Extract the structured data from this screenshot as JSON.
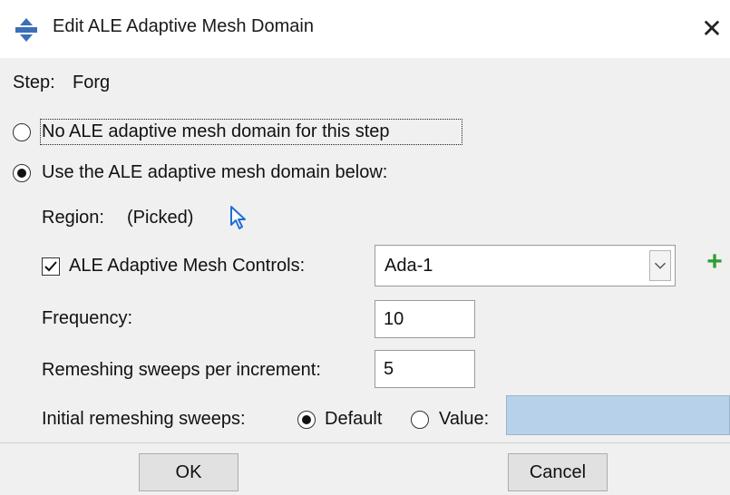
{
  "window": {
    "title": "Edit ALE Adaptive Mesh Domain",
    "close_glyph": "✕",
    "icon": "abaqus-app-icon"
  },
  "step": {
    "label": "Step:",
    "value": "Forg"
  },
  "options": {
    "no_domain": {
      "label": "No ALE adaptive mesh domain for this step",
      "selected": false
    },
    "use_domain": {
      "label": "Use the ALE adaptive mesh domain below:",
      "selected": true
    }
  },
  "region": {
    "label": "Region:",
    "value": "(Picked)",
    "icon": "pick-cursor-icon"
  },
  "controls": {
    "label": "ALE Adaptive Mesh Controls:",
    "checked": true,
    "selected": "Ada-1",
    "add_icon": "+"
  },
  "frequency": {
    "label": "Frequency:",
    "value": "10"
  },
  "remeshing": {
    "label": "Remeshing sweeps per increment:",
    "value": "5"
  },
  "initial": {
    "label": "Initial remeshing sweeps:",
    "default_label": "Default",
    "value_label": "Value:",
    "default_selected": true,
    "value": ""
  },
  "buttons": {
    "ok": "OK",
    "cancel": "Cancel"
  },
  "colors": {
    "background": "#f0f0f0",
    "value_field_disabled": "#b8d1ea",
    "add_green": "#2e9e32",
    "cursor_blue": "#1e6fd9"
  }
}
